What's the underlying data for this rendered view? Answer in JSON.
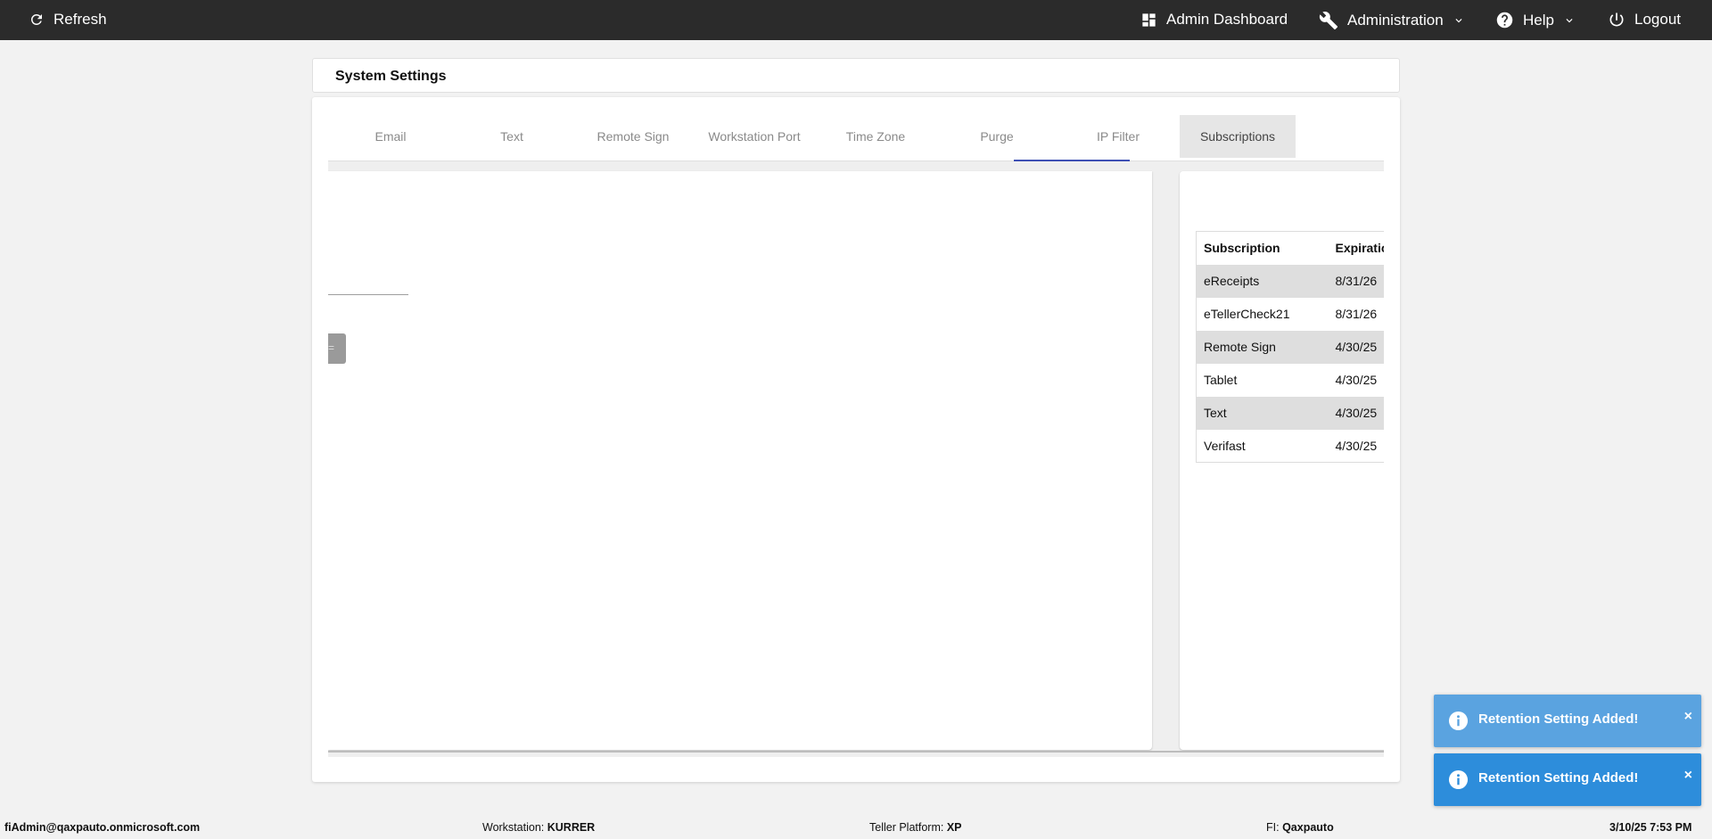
{
  "topbar": {
    "refresh_label": "Refresh",
    "admin_dashboard_label": "Admin Dashboard",
    "administration_label": "Administration",
    "help_label": "Help",
    "logout_label": "Logout"
  },
  "page": {
    "title": "System Settings"
  },
  "tabs": [
    {
      "label": "Email"
    },
    {
      "label": "Text"
    },
    {
      "label": "Remote Sign"
    },
    {
      "label": "Workstation Port"
    },
    {
      "label": "Time Zone"
    },
    {
      "label": "Purge"
    },
    {
      "label": "IP Filter"
    },
    {
      "label": "Subscriptions"
    }
  ],
  "subscriptions": {
    "headers": [
      "Subscription",
      "Expiration"
    ],
    "rows": [
      {
        "name": "eReceipts",
        "expiration": "8/31/26"
      },
      {
        "name": "eTellerCheck21",
        "expiration": "8/31/26"
      },
      {
        "name": "Remote Sign",
        "expiration": "4/30/25"
      },
      {
        "name": "Tablet",
        "expiration": "4/30/25"
      },
      {
        "name": "Text",
        "expiration": "4/30/25"
      },
      {
        "name": "Verifast",
        "expiration": "4/30/25"
      }
    ]
  },
  "toasts": [
    {
      "message": "Retention Setting Added!",
      "close": "×"
    },
    {
      "message": "Retention Setting Added!",
      "close": "×"
    }
  ],
  "status": {
    "user": "fiAdmin@qaxpauto.onmicrosoft.com",
    "workstation_label": "Workstation:",
    "workstation_value": "KURRER",
    "platform_label": "Teller Platform:",
    "platform_value": "XP",
    "fi_label": "FI:",
    "fi_value": "Qaxpauto",
    "datetime": "3/10/25 7:53 PM"
  },
  "colors": {
    "topbar": "#2b2b2b",
    "tab_indicator": "#3f51b5",
    "toast_light": "#5aa3e0",
    "toast_dark": "#2d8ddb"
  }
}
